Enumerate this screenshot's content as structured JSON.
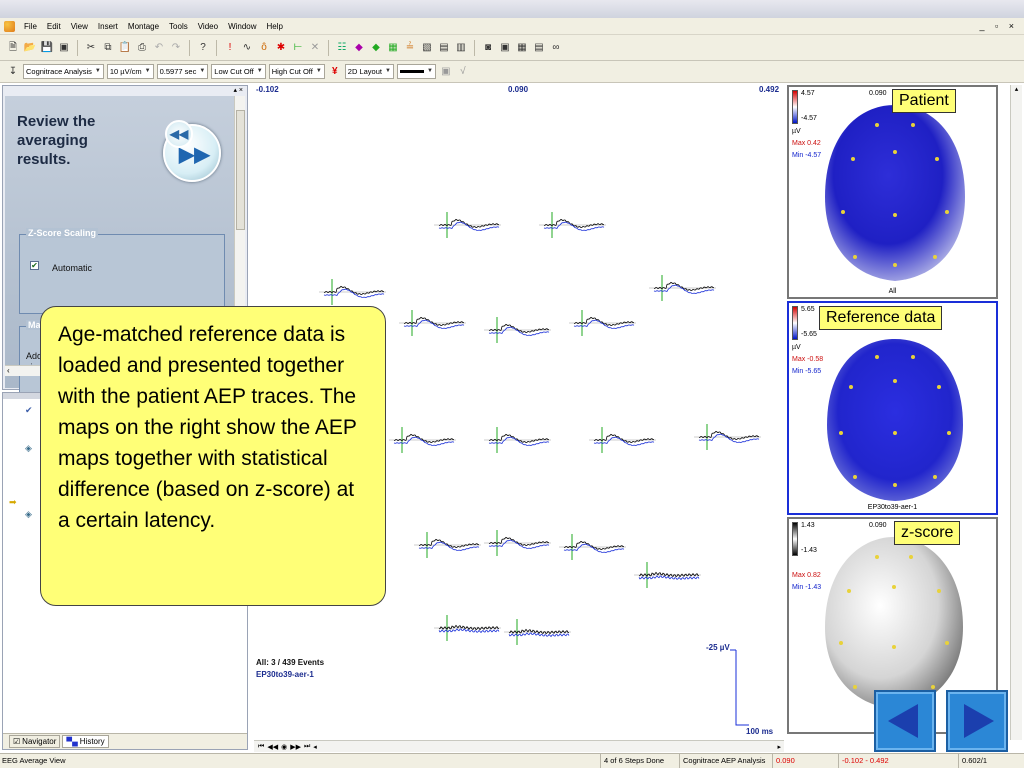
{
  "menu": {
    "items": [
      "File",
      "Edit",
      "View",
      "Insert",
      "Montage",
      "Tools",
      "Video",
      "Window",
      "Help"
    ],
    "window_controls": "_ ▫ ×"
  },
  "toolbar2": {
    "analysis": "Cognitrace Analysis",
    "sensitivity": "10 µV/cm",
    "timebase": "0.5977 sec",
    "low_cut": "Low Cut Off",
    "high_cut": "High Cut Off",
    "layout": "2D Layout"
  },
  "left_panel": {
    "title": "Review the averaging results.",
    "zscore_group": "Z-Score Scaling",
    "automatic_label": "Automatic",
    "automatic_checked": true,
    "map_group": "Mar",
    "map_text_line1": "Ado",
    "map_text_line2": "viev"
  },
  "navigator": {
    "tab_navigator": "Navigator",
    "tab_history": "History"
  },
  "main": {
    "lat_left": "-0.102",
    "lat_mid": "0.090",
    "lat_right": "0.492",
    "events": "All: 3 / 439 Events",
    "dataset": "EP30to39-aer-1",
    "scale_uv": "-25 µV",
    "scale_ms": "100 ms",
    "wave_colors": {
      "patient": "#000000",
      "reference": "#1a2fd8",
      "marker": "#22aa22"
    }
  },
  "maps": {
    "patient": {
      "max": "4.57",
      "min": "-4.57",
      "unit": "µV",
      "stat_max": "Max  0.42",
      "stat_min": "Min  -4.57",
      "latency": "0.090",
      "caption": "All",
      "label": "Patient"
    },
    "reference": {
      "max": "5.65",
      "min": "-5.65",
      "unit": "µV",
      "stat_max": "Max  -0.58",
      "stat_min": "Min  -5.65",
      "caption": "EP30to39-aer-1",
      "label": "Reference data"
    },
    "zscore": {
      "max": "1.43",
      "min": "-1.43",
      "stat_max": "Max  0.82",
      "stat_min": "Min  -1.43",
      "latency": "0.090",
      "label": "z-score"
    }
  },
  "callout": {
    "text": "Age-matched reference data is loaded and presented together with the patient AEP traces. The maps on the right show the AEP maps together with statistical difference (based on z-score) at a certain latency."
  },
  "status": {
    "left": "EEG Average View",
    "steps": "4 of 6 Steps Done",
    "analysis": "Cognitrace AEP Analysis",
    "latency": "0.090",
    "range": "-0.102 - 0.492",
    "page": "0.602/1"
  },
  "colors": {
    "accent": "#2b87d6",
    "callout": "#ffff77",
    "map_blue": "#1a2fd8"
  }
}
